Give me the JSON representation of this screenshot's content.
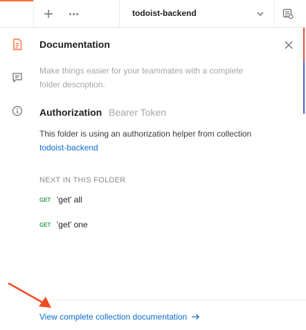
{
  "topbar": {
    "workspace_name": "todoist-backend"
  },
  "panel": {
    "title": "Documentation",
    "description": "Make things easier for your teammates with a complete folder description.",
    "authorization": {
      "title": "Authorization",
      "type": "Bearer Token",
      "text": "This folder is using an authorization helper from collection",
      "link": "todoist-backend"
    },
    "next_in_folder": {
      "heading": "NEXT IN THIS FOLDER",
      "requests": [
        {
          "method": "GET",
          "name": "'get' all"
        },
        {
          "method": "GET",
          "name": "'get' one"
        }
      ]
    },
    "footer_link": "View complete collection documentation"
  },
  "colors": {
    "accent": "#ff6c37",
    "link": "#0b6ccf",
    "get_method": "#2e9d4f",
    "annotation_arrow": "#ef4a23"
  },
  "icons": {
    "rail": [
      "document-icon",
      "comments-icon",
      "info-icon"
    ],
    "topbar": [
      "plus-icon",
      "more-icon",
      "chevron-down-icon",
      "environment-icon"
    ],
    "close": "close-icon",
    "footer": "arrow-right-icon"
  }
}
